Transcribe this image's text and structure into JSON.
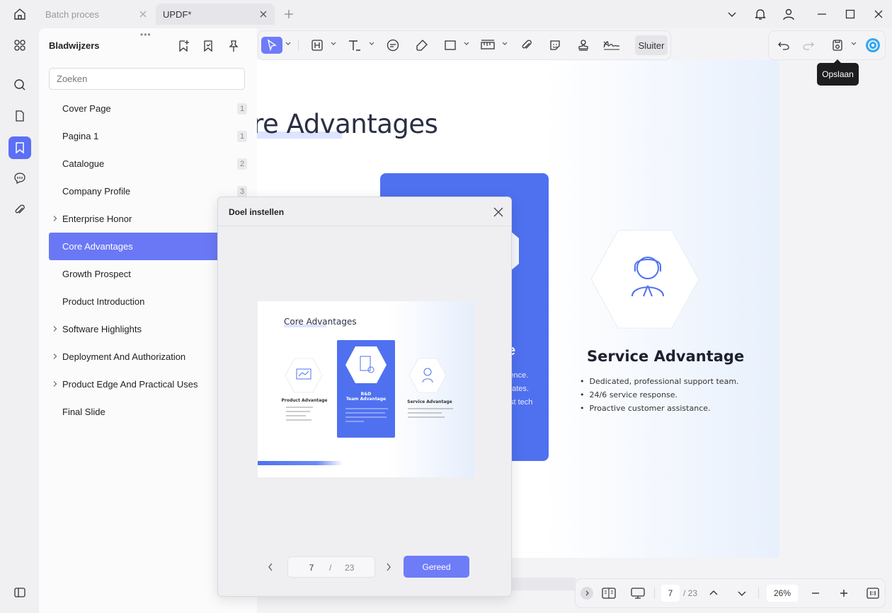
{
  "tabs": [
    {
      "label": "Batch proces"
    },
    {
      "label": "UPDF*"
    }
  ],
  "panel": {
    "title": "Bladwijzers",
    "search_placeholder": "Zoeken",
    "bookmarks": [
      {
        "label": "Cover Page",
        "page": "1",
        "expandable": false
      },
      {
        "label": "Pagina 1",
        "page": "1",
        "expandable": false
      },
      {
        "label": "Catalogue",
        "page": "2",
        "expandable": false
      },
      {
        "label": "Company Profile",
        "page": "3",
        "expandable": false
      },
      {
        "label": "Enterprise Honor",
        "page": "",
        "expandable": true
      },
      {
        "label": "Core Advantages",
        "page": "",
        "expandable": false,
        "active": true
      },
      {
        "label": "Growth Prospect",
        "page": "",
        "expandable": false
      },
      {
        "label": "Product Introduction",
        "page": "",
        "expandable": false
      },
      {
        "label": "Software Highlights",
        "page": "",
        "expandable": true
      },
      {
        "label": "Deployment And Authorization",
        "page": "",
        "expandable": true
      },
      {
        "label": "Product Edge And Practical Uses",
        "page": "",
        "expandable": true
      },
      {
        "label": "Final Slide",
        "page": "",
        "expandable": false
      }
    ]
  },
  "toolbar": {
    "close_label": "Sluiter",
    "save_tooltip": "Opslaan"
  },
  "document": {
    "heading": "ore Advantages",
    "card_fragments": [
      "e",
      "ience.",
      "dates.",
      "st tech"
    ],
    "service_title": "Service Advantage",
    "service_points": [
      "Dedicated, professional support team.",
      "24/6 service response.",
      "Proactive customer assistance."
    ]
  },
  "modal": {
    "title": "Doel instellen",
    "thumbnail": {
      "title": "Core Advantages",
      "cards": [
        {
          "title": "Product Advantage"
        },
        {
          "title": "R&D\nTeam Advantage"
        },
        {
          "title": "Service Advantage"
        }
      ]
    },
    "current_page": "7",
    "separator": "/",
    "total_pages": "23",
    "done_label": "Gereed"
  },
  "statusbar": {
    "page_current": "7",
    "page_total": "/ 23",
    "zoom": "26%"
  },
  "colors": {
    "accent": "#6e7cf8",
    "card_blue": "#4f71f0"
  }
}
